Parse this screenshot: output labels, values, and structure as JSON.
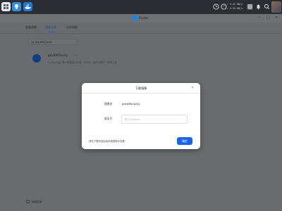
{
  "taskbar": {
    "apps": [
      {
        "icon": "grid-menu-icon"
      },
      {
        "icon": "lightbulb-icon"
      },
      {
        "icon": "docker-whale-icon"
      }
    ],
    "net_up": "↑ 3.41 KB/s",
    "net_down": "↓ 4.34 KB/s"
  },
  "window": {
    "title": "Docker",
    "tabs": [
      {
        "label": "容器镜像",
        "active": false
      },
      {
        "label": "镜像仓库",
        "active": true
      },
      {
        "label": "本地镜像",
        "active": false
      }
    ],
    "search_value": "gdy666/lucky",
    "result": {
      "title": "gdy666/lucky",
      "stars": "☆ 0",
      "description": "Lucky(大吉) 是一款集端口转发、DDNS、反向代理于一体的工具"
    },
    "bottom_option": "隐藏容器"
  },
  "modal": {
    "title": "下载镜像",
    "image_label": "镜像名",
    "image_value": "gdy666/lucky",
    "tag_label": "版本号",
    "tag_placeholder": "默认为latest",
    "hint": "请在下载完成后到本地镜像中查看",
    "confirm_label": "确定"
  },
  "colors": {
    "accent": "#1a64e6",
    "taskbar": "#2a2d33",
    "overlay": "#6a6b6e"
  }
}
